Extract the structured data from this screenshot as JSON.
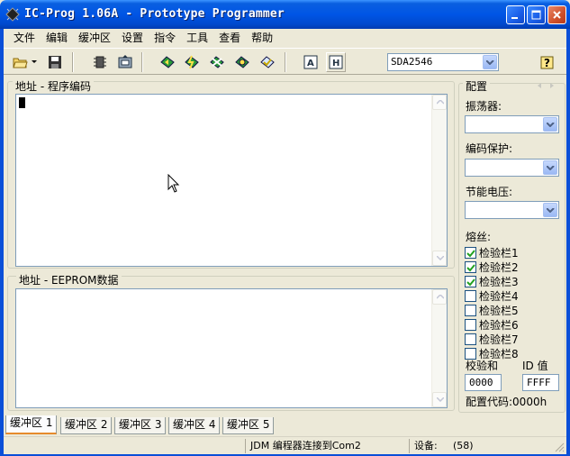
{
  "window": {
    "title": "IC-Prog 1.06A - Prototype Programmer"
  },
  "menu": {
    "items": [
      "文件",
      "编辑",
      "缓冲区",
      "设置",
      "指令",
      "工具",
      "查看",
      "帮助"
    ]
  },
  "toolbar": {
    "device_value": "SDA2546"
  },
  "panels": {
    "program_title": "地址 - 程序编码",
    "eeprom_title": "地址 - EEPROM数据"
  },
  "config": {
    "title": "配置",
    "oscillator_label": "振荡器:",
    "code_protect_label": "编码保护:",
    "voltage_label": "节能电压:",
    "fuses_label": "熔丝:",
    "fuses": [
      {
        "label": "检验栏1",
        "checked": true
      },
      {
        "label": "检验栏2",
        "checked": true
      },
      {
        "label": "检验栏3",
        "checked": true
      },
      {
        "label": "检验栏4",
        "checked": false
      },
      {
        "label": "检验栏5",
        "checked": false
      },
      {
        "label": "检验栏6",
        "checked": false
      },
      {
        "label": "检验栏7",
        "checked": false
      },
      {
        "label": "检验栏8",
        "checked": false
      }
    ],
    "checksum_label": "校验和",
    "checksum_value": "0000",
    "id_label": "ID 值",
    "id_value": "FFFF",
    "config_code_label": "配置代码:0000h"
  },
  "tabs": [
    "缓冲区 1",
    "缓冲区 2",
    "缓冲区 3",
    "缓冲区 4",
    "缓冲区 5"
  ],
  "status": {
    "connection": "JDM 编程器连接到Com2",
    "device_label": "设备:",
    "device_value": "(58)"
  }
}
